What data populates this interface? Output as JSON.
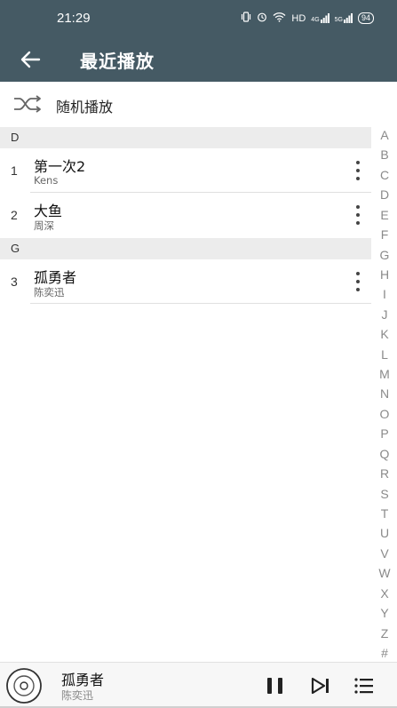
{
  "status_bar": {
    "time": "21:29",
    "network_label": "HD",
    "signal_1": "4G",
    "signal_2": "5G",
    "battery": "94"
  },
  "app_bar": {
    "title": "最近播放",
    "back_icon": "arrow-left-icon"
  },
  "shuffle": {
    "label": "随机播放",
    "icon": "shuffle-icon"
  },
  "sections": [
    {
      "header": "D",
      "songs": [
        {
          "index": "1",
          "title": "第一次2",
          "artist": "Kens"
        },
        {
          "index": "2",
          "title": "大鱼",
          "artist": "周深"
        }
      ]
    },
    {
      "header": "G",
      "songs": [
        {
          "index": "3",
          "title": "孤勇者",
          "artist": "陈奕迅"
        }
      ]
    }
  ],
  "alphabet": [
    "A",
    "B",
    "C",
    "D",
    "E",
    "F",
    "G",
    "H",
    "I",
    "J",
    "K",
    "L",
    "M",
    "N",
    "O",
    "P",
    "Q",
    "R",
    "S",
    "T",
    "U",
    "V",
    "W",
    "X",
    "Y",
    "Z",
    "#"
  ],
  "now_playing": {
    "title": "孤勇者",
    "artist": "陈奕迅",
    "state": "playing"
  },
  "colors": {
    "app_bar": "#455a64",
    "section_header": "#ececec",
    "alpha_index": "#8a8a8a"
  }
}
